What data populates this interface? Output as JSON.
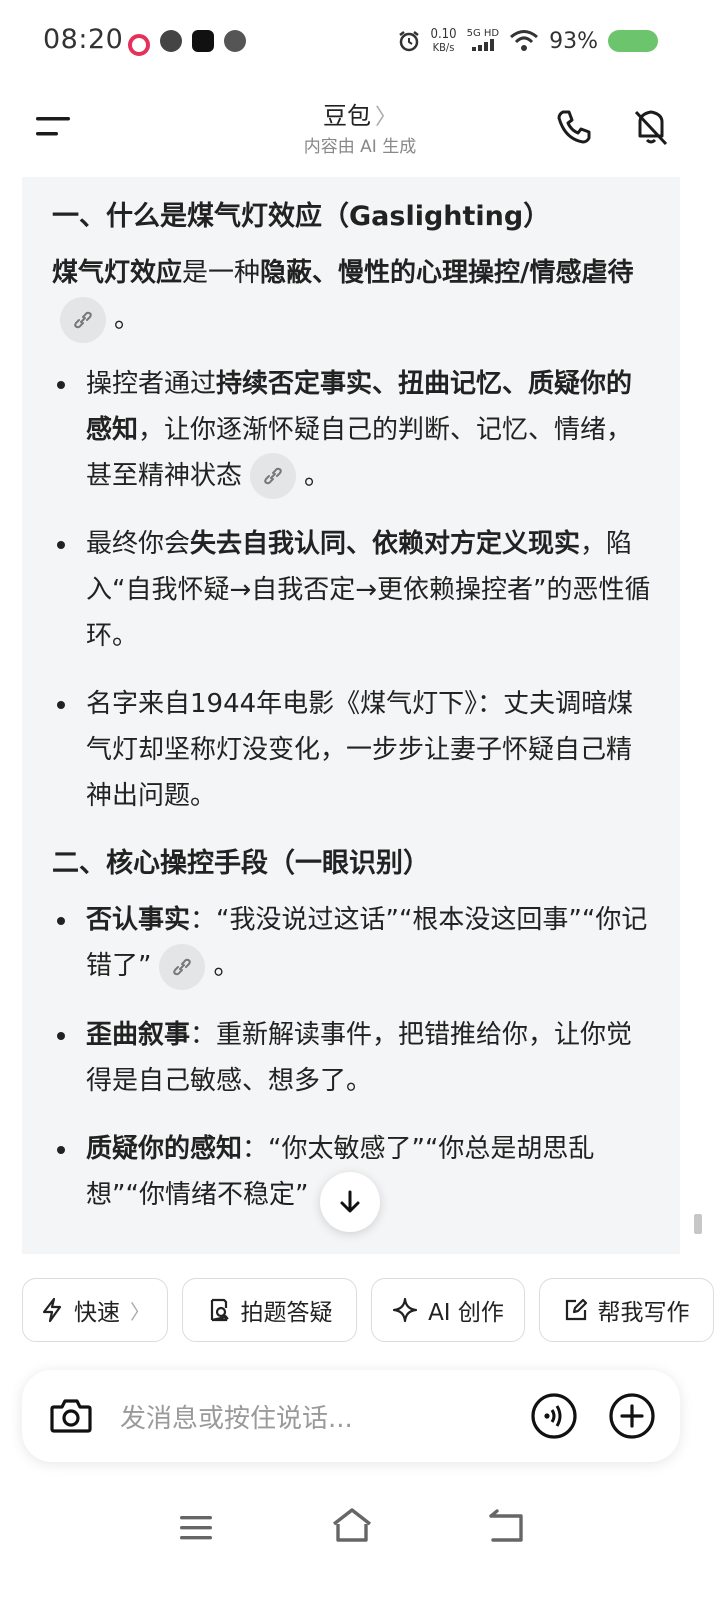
{
  "status_bar": {
    "time": "08:20",
    "net_speed_value": "0.10",
    "net_speed_unit": "KB/s",
    "network": "5G HD",
    "battery_percent": "93%",
    "battery_color": "#6cc56c"
  },
  "header": {
    "title": "豆包",
    "title_chevron": "〉",
    "subtitle": "内容由 AI 生成"
  },
  "message": {
    "section1_title": "一、什么是煤气灯效应（Gaslighting）",
    "intro": {
      "b1": "煤气灯效应",
      "t1": "是一种",
      "b2": "隐蔽、慢性的心理操控/情感虐待",
      "t2": "。"
    },
    "bullets1": [
      {
        "t1": "操控者通过",
        "b1": "持续否定事实、扭曲记忆、质疑你的感知",
        "t2": "，让你逐渐怀疑自己的判断、记忆、情绪，甚至精神状态",
        "t3": "。"
      },
      {
        "t1": "最终你会",
        "b1": "失去自我认同、依赖对方定义现实",
        "t2": "，陷入“自我怀疑→自我否定→更依赖操控者”的恶性循环。"
      },
      {
        "t1": "名字来自1944年电影《煤气灯下》：丈夫调暗煤气灯却坚称灯没变化，一步步让妻子怀疑自己精神出问题。"
      }
    ],
    "section2_title": "二、核心操控手段（一眼识别）",
    "bullets2": [
      {
        "b1": "否认事实",
        "t1": "：“我没说过这话”“根本没这回事”“你记错了”",
        "t2": "。"
      },
      {
        "b1": "歪曲叙事",
        "t1": "：重新解读事件，把错推给你，让你觉得是自己敏感、想多了。"
      },
      {
        "b1": "质疑你的感知",
        "t1": "：“你太敏感了”“你总是胡思乱想”“你情绪不稳定”"
      }
    ]
  },
  "quick_actions": [
    {
      "label": "快速",
      "icon": "bolt-icon",
      "chevron": "〉"
    },
    {
      "label": "拍题答疑",
      "icon": "scan-doc-icon"
    },
    {
      "label": "AI 创作",
      "icon": "sparkle-icon"
    },
    {
      "label": "帮我写作",
      "icon": "edit-icon"
    }
  ],
  "input": {
    "placeholder": "发消息或按住说话..."
  },
  "colors": {
    "card_bg": "#f4f5f6",
    "text": "#222222",
    "muted": "#888888"
  }
}
